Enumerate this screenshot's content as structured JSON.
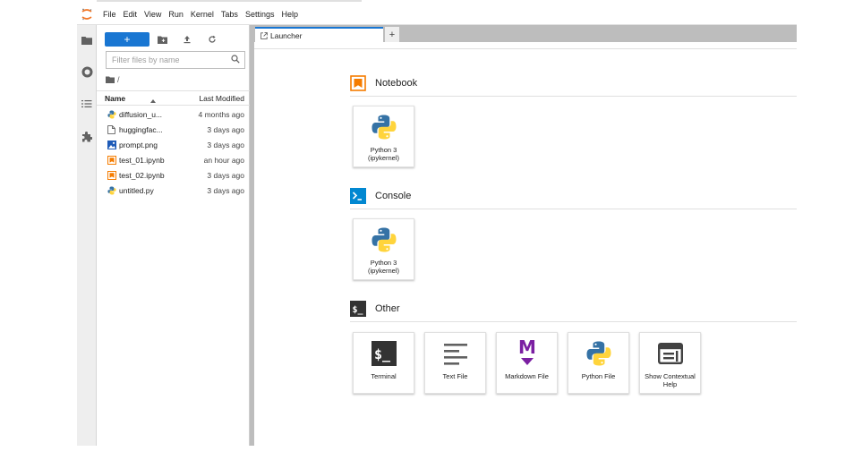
{
  "colors": {
    "accent": "#1976d2",
    "notebook_orange": "#f57c00",
    "console_blue": "#0288d1",
    "markdown_purple": "#7b1fa2",
    "terminal_dark": "#333333"
  },
  "menu": [
    "File",
    "Edit",
    "View",
    "Run",
    "Kernel",
    "Tabs",
    "Settings",
    "Help"
  ],
  "sidebar_icons": [
    "folder-icon",
    "running-icon",
    "toc-icon",
    "extension-icon"
  ],
  "filebrowser": {
    "new_label": "+",
    "filter_placeholder": "Filter files by name",
    "breadcrumb": "/",
    "header": {
      "name": "Name",
      "modified": "Last Modified"
    },
    "files": [
      {
        "name": "diffusion_u...",
        "modified": "4 months ago",
        "icon": "python-file-icon"
      },
      {
        "name": "huggingfac...",
        "modified": "3 days ago",
        "icon": "generic-file-icon"
      },
      {
        "name": "prompt.png",
        "modified": "3 days ago",
        "icon": "image-file-icon"
      },
      {
        "name": "test_01.ipynb",
        "modified": "an hour ago",
        "icon": "notebook-file-icon"
      },
      {
        "name": "test_02.ipynb",
        "modified": "3 days ago",
        "icon": "notebook-file-icon"
      },
      {
        "name": "untitled.py",
        "modified": "3 days ago",
        "icon": "python-file-icon"
      }
    ]
  },
  "tabs": {
    "active": "Launcher",
    "add": "+"
  },
  "launcher": {
    "notebook": {
      "title": "Notebook",
      "cards": [
        {
          "label": "Python 3 (ipykernel)"
        }
      ]
    },
    "console": {
      "title": "Console",
      "cards": [
        {
          "label": "Python 3 (ipykernel)"
        }
      ]
    },
    "other": {
      "title": "Other",
      "cards": [
        {
          "label": "Terminal"
        },
        {
          "label": "Text File"
        },
        {
          "label": "Markdown File"
        },
        {
          "label": "Python File"
        },
        {
          "label": "Show Contextual Help"
        }
      ]
    }
  }
}
